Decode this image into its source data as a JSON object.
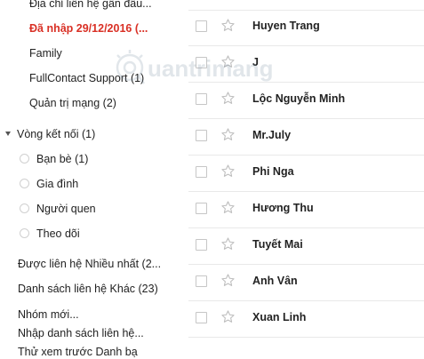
{
  "sidebar": {
    "top_items": [
      {
        "label": "Địa chỉ liên hệ gần đâu...",
        "highlight": false
      },
      {
        "label": "Đã nhập 29/12/2016 (...",
        "highlight": true
      },
      {
        "label": "Family",
        "highlight": false
      },
      {
        "label": "FullContact Support (1)",
        "highlight": false
      },
      {
        "label": "Quản trị mạng (2)",
        "highlight": false
      }
    ],
    "circles": {
      "label": "Vòng kết nối (1)",
      "items": [
        "Bạn bè (1)",
        "Gia đình",
        "Người quen",
        "Theo dõi"
      ]
    },
    "bottom_items": [
      "Được liên hệ Nhiều nhất (2...",
      "Danh sách liên hệ Khác (23)"
    ],
    "actions": [
      "Nhóm mới...",
      "Nhập danh sách liên hệ...",
      "Thử xem trước Danh bạ"
    ]
  },
  "contacts": [
    {
      "name": "Huyen Trang"
    },
    {
      "name": "J"
    },
    {
      "name": "Lộc Nguyễn Minh"
    },
    {
      "name": "Mr.July"
    },
    {
      "name": "Phi Nga"
    },
    {
      "name": "Hương Thu"
    },
    {
      "name": "Tuyết Mai"
    },
    {
      "name": "Anh Vân"
    },
    {
      "name": "Xuan Linh"
    }
  ],
  "watermark": {
    "text": "uantrimang"
  },
  "colors": {
    "highlight": "#d93025",
    "border": "#e9e9e9",
    "star": "#bdbdbd"
  }
}
